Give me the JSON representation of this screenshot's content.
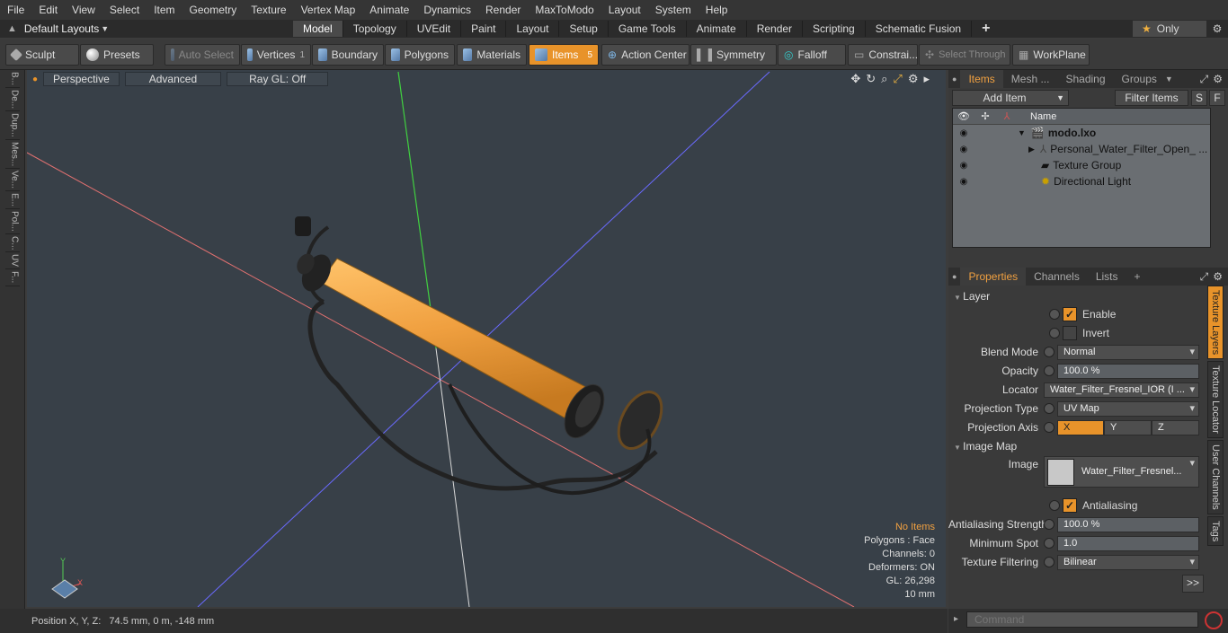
{
  "menubar": {
    "items": [
      "File",
      "Edit",
      "View",
      "Select",
      "Item",
      "Geometry",
      "Texture",
      "Vertex Map",
      "Animate",
      "Dynamics",
      "Render",
      "MaxToModo",
      "Layout",
      "System",
      "Help"
    ]
  },
  "tabbar": {
    "layout_selector": "Default Layouts",
    "tabs": [
      "Model",
      "Topology",
      "UVEdit",
      "Paint",
      "Layout",
      "Setup",
      "Game Tools",
      "Animate",
      "Render",
      "Scripting",
      "Schematic Fusion"
    ],
    "active_tab": "Model",
    "add_label": "+",
    "only_label": "Only"
  },
  "toolbar": {
    "sculpt": "Sculpt",
    "presets": "Presets",
    "auto_select": "Auto Select",
    "vertices": "Vertices",
    "vertices_count": "1",
    "boundary": "Boundary",
    "polygons": "Polygons",
    "materials": "Materials",
    "items": "Items",
    "items_count": "5",
    "action_center": "Action Center",
    "symmetry": "Symmetry",
    "falloff": "Falloff",
    "constraints": "Constrai...",
    "select_through": "Select Through",
    "workplane": "WorkPlane"
  },
  "left_tabs": [
    "B...",
    "De...",
    "Dup...",
    "Mes...",
    "Ve...",
    "E...",
    "Pol...",
    "C...",
    "UV",
    "F..."
  ],
  "viewport": {
    "perspective": "Perspective",
    "advanced": "Advanced",
    "raygl": "Ray GL: Off",
    "info": {
      "no_items": "No Items",
      "polygons": "Polygons : Face",
      "channels": "Channels: 0",
      "deformers": "Deformers: ON",
      "gl": "GL: 26,298",
      "scale": "10 mm"
    },
    "axis_y": "Y",
    "axis_x": "X"
  },
  "statusbar": {
    "position": "Position X, Y, Z:   74.5 mm, 0 m, -148 mm"
  },
  "items_panel": {
    "tabs": [
      "Items",
      "Mesh ...",
      "Shading",
      "Groups"
    ],
    "add_item": "Add Item",
    "filter_items": "Filter Items",
    "btn_s": "S",
    "btn_f": "F",
    "name_header": "Name",
    "rows": [
      {
        "label": "modo.lxo"
      },
      {
        "label": "Personal_Water_Filter_Open_ ..."
      },
      {
        "label": "Texture Group"
      },
      {
        "label": "Directional Light"
      }
    ]
  },
  "properties_panel": {
    "tabs": [
      "Properties",
      "Channels",
      "Lists",
      "+"
    ],
    "layer_section": "Layer",
    "enable": "Enable",
    "invert": "Invert",
    "blend_mode_label": "Blend Mode",
    "blend_mode_value": "Normal",
    "opacity_label": "Opacity",
    "opacity_value": "100.0 %",
    "locator_label": "Locator",
    "locator_value": "Water_Filter_Fresnel_IOR (I ...",
    "projection_type_label": "Projection Type",
    "projection_type_value": "UV Map",
    "projection_axis_label": "Projection Axis",
    "axis_x": "X",
    "axis_y": "Y",
    "axis_z": "Z",
    "image_map_section": "Image Map",
    "image_label": "Image",
    "image_value": "Water_Filter_Fresnel...",
    "antialiasing": "Antialiasing",
    "aa_strength_label": "Antialiasing Strength",
    "aa_strength_value": "100.0 %",
    "min_spot_label": "Minimum Spot",
    "min_spot_value": "1.0",
    "tex_filter_label": "Texture Filtering",
    "tex_filter_value": "Bilinear",
    "more": ">>",
    "side_tabs": [
      "Texture Layers",
      "Texture Locator",
      "User Channels",
      "Tags"
    ]
  },
  "command": {
    "placeholder": "Command"
  },
  "colors": {
    "accent": "#e8932a",
    "viewport_bg": "#384048"
  }
}
